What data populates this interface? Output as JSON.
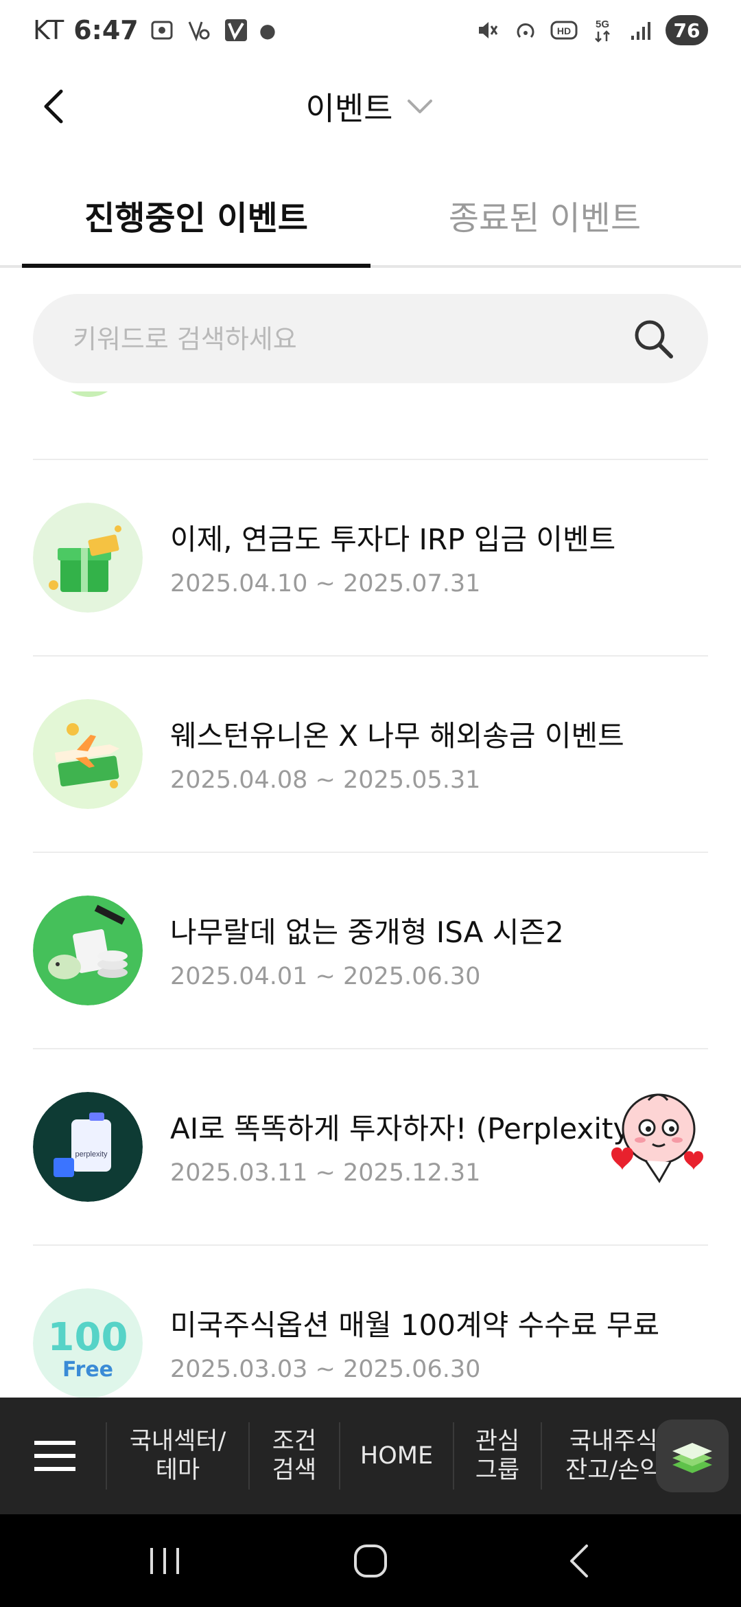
{
  "status_bar": {
    "carrier": "KT",
    "time": "6:47",
    "battery": "76",
    "network": "5G"
  },
  "header": {
    "title": "이벤트"
  },
  "tabs": [
    {
      "label": "진행중인 이벤트",
      "active": true
    },
    {
      "label": "종료된 이벤트",
      "active": false
    }
  ],
  "search": {
    "placeholder": "키워드로 검색하세요"
  },
  "events": [
    {
      "title": "이제, 연금도 투자다 IRP 입금 이벤트",
      "date": "2025.04.10 ~ 2025.07.31",
      "icon": "gift-box-icon"
    },
    {
      "title": "웨스턴유니온 X 나무 해외송금 이벤트",
      "date": "2025.04.08 ~ 2025.05.31",
      "icon": "airplane-icon"
    },
    {
      "title": "나무랄데 없는 중개형 ISA 시즌2",
      "date": "2025.04.01 ~ 2025.06.30",
      "icon": "piggy-bank-icon"
    },
    {
      "title": "AI로 똑똑하게 투자하자! (Perplexity)",
      "date": "2025.03.11 ~ 2025.12.31",
      "icon": "perplexity-device-icon",
      "thumb_text": "perplexity"
    },
    {
      "title": "미국주식옵션 매월 100계약 수수료 무료",
      "date": "2025.03.03 ~ 2025.06.30",
      "icon": "100-free-icon",
      "thumb_number": "100",
      "thumb_text": "Free"
    }
  ],
  "bottom_nav": {
    "items": [
      {
        "label": "국내섹터/\n테마"
      },
      {
        "label": "조건\n검색"
      },
      {
        "label": "HOME"
      },
      {
        "label": "관심\n그룹"
      },
      {
        "label": "국내주식\n잔고/손익"
      }
    ]
  },
  "colors": {
    "accent_text": "#111111",
    "muted_text": "#9b9b9b",
    "bottom_nav_bg": "#242424",
    "search_bg": "#f2f2f2"
  }
}
